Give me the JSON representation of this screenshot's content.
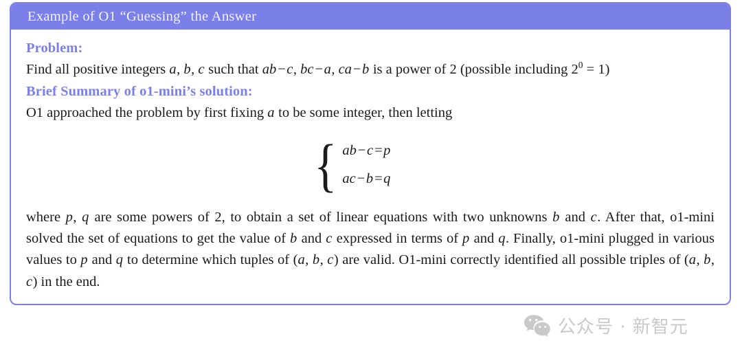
{
  "callout": {
    "title": "Example of O1 “Guessing” the Answer",
    "accent_color": "#7b7fe8",
    "header_text_color": "#f2f2fb",
    "body_text_color": "#1a1a1a",
    "problem_heading": "Problem:",
    "problem_text_part1": "Find all positive integers ",
    "problem_var_a": "a",
    "problem_comma1": ", ",
    "problem_var_b": "b",
    "problem_comma2": ", ",
    "problem_var_c": "c",
    "problem_text_part2": " such that ",
    "problem_expr1": "ab",
    "problem_minus1": "−",
    "problem_expr1b": "c",
    "problem_comma3": ", ",
    "problem_expr2": "bc",
    "problem_minus2": "−",
    "problem_expr2b": "a",
    "problem_comma4": ", ",
    "problem_expr3": "ca",
    "problem_minus3": "−",
    "problem_expr3b": "b",
    "problem_text_part3": " is a power of 2 (possible including ",
    "problem_power_base": "2",
    "problem_power_exp": "0",
    "problem_power_eq": " = 1)",
    "summary_heading": "Brief Summary of o1-mini’s solution:",
    "summary_line1_part1": "O1 approached the problem by first fixing ",
    "summary_line1_var": "a",
    "summary_line1_part2": " to be some integer, then letting",
    "equation": {
      "brace": "{",
      "row1": {
        "lhs1": "ab",
        "minus": "−",
        "lhs2": "c",
        "equals": "=",
        "rhs": "p"
      },
      "row2": {
        "lhs1": "ac",
        "minus": "−",
        "lhs2": "b",
        "equals": "=",
        "rhs": "q"
      }
    },
    "closing_p1": "where ",
    "closing_var_p": "p",
    "closing_comma": ", ",
    "closing_var_q": "q",
    "closing_p2": " are some powers of 2, to obtain a set of linear equations with two unknowns ",
    "closing_var_b": "b",
    "closing_and1": " and ",
    "closing_var_c": "c",
    "closing_p3": ". After that, o1-mini solved the set of equations to get the value of ",
    "closing_var_b2": "b",
    "closing_and2": " and ",
    "closing_var_c2": "c",
    "closing_p4": " expressed in terms of ",
    "closing_var_p2": "p",
    "closing_and3": " and ",
    "closing_var_q2": "q",
    "closing_p5": ". Finally, o1-mini plugged in various values to ",
    "closing_var_p3": "p",
    "closing_and4": " and ",
    "closing_var_q3": "q",
    "closing_p6": " to determine which tuples of (",
    "closing_tuple_a": "a",
    "closing_tuple_c1": ", ",
    "closing_tuple_b": "b",
    "closing_tuple_c2": ", ",
    "closing_tuple_c": "c",
    "closing_p7": ") are valid. O1-mini correctly identified all possible triples of (",
    "closing_tuple2_a": "a",
    "closing_tuple2_c1": ", ",
    "closing_tuple2_b": "b",
    "closing_tuple2_c2": ", ",
    "closing_tuple2_c": "c",
    "closing_p8": ") in the end."
  },
  "watermark": {
    "icon": "wechat-logo-icon",
    "text": "公众号 · 新智元",
    "color": "#c9c9c9"
  }
}
